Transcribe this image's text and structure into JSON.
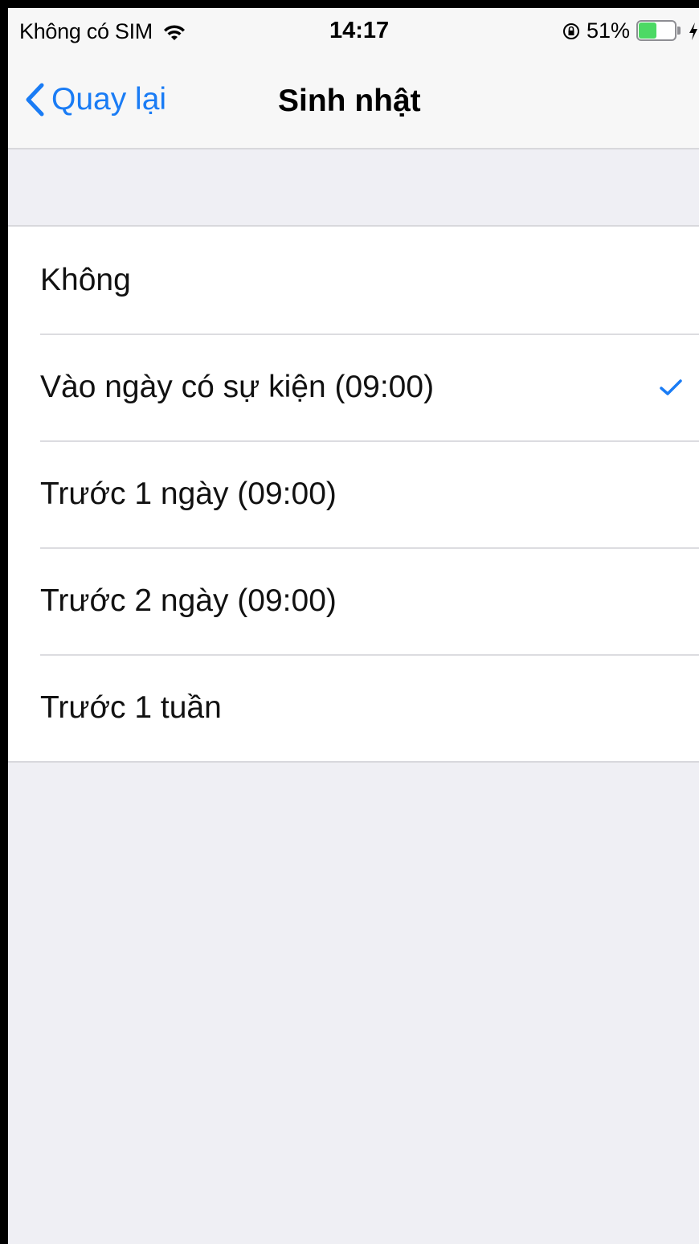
{
  "status_bar": {
    "carrier": "Không có SIM",
    "time": "14:17",
    "battery_percent": "51%",
    "battery_level": 0.51,
    "battery_color": "#4cd964"
  },
  "nav": {
    "back_label": "Quay lại",
    "title": "Sinh nhật"
  },
  "options": [
    {
      "label": "Không",
      "selected": false
    },
    {
      "label": "Vào ngày có sự kiện (09:00)",
      "selected": true
    },
    {
      "label": "Trước 1 ngày (09:00)",
      "selected": false
    },
    {
      "label": "Trước 2 ngày (09:00)",
      "selected": false
    },
    {
      "label": "Trước 1 tuần",
      "selected": false
    }
  ],
  "colors": {
    "accent": "#1a7cf5",
    "background": "#efeff4"
  },
  "icons": {
    "back": "chevron-left-icon",
    "selected": "check-icon",
    "wifi": "wifi-icon",
    "lock": "orientation-lock-icon",
    "battery": "battery-icon",
    "charging": "charge-icon"
  }
}
